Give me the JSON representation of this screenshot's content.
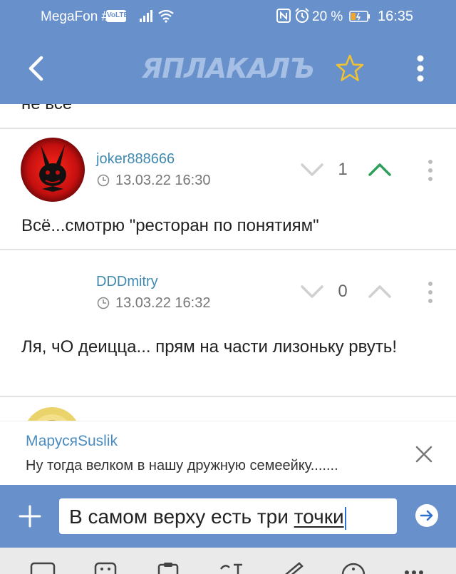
{
  "status_bar": {
    "carrier": "MegaFon #1",
    "volte": "VoLTE",
    "battery_percent": "20 %",
    "time": "16:35"
  },
  "app_bar": {
    "logo": "ЯПЛАКАЛЪ"
  },
  "feed": {
    "cut_text": "не все",
    "posts": [
      {
        "username": "joker888666",
        "date": "13.03.22 16:30",
        "votes": "1",
        "text": "Всё...смотрю \"ресторан по понятиям\""
      },
      {
        "username": "DDDmitry",
        "date": "13.03.22 16:32",
        "votes": "0",
        "text": "Ля, чО деицца... прям на части лизоньку рвуть!"
      }
    ]
  },
  "reply": {
    "name": "МарусяSuslik",
    "text": "Ну тогда велком в нашу дружную семеейку......."
  },
  "composer": {
    "text_main": "В самом верху есть три ",
    "text_underlined": "точки"
  },
  "colors": {
    "primary": "#6891cc",
    "link": "#3f8ab0",
    "upvote_active": "#2e9e5a",
    "star": "#f1c232"
  }
}
